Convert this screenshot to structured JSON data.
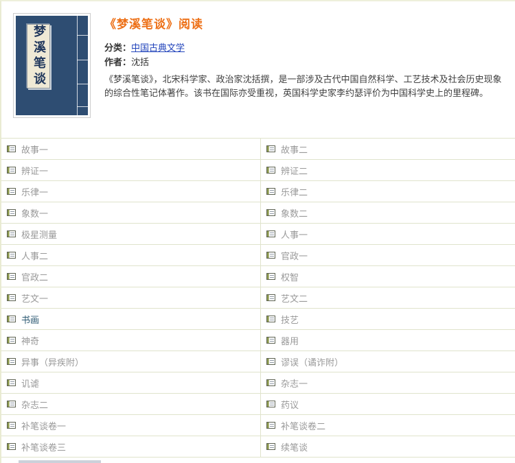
{
  "page": {
    "accent_color": "#ed7017",
    "link_color": "#2244bb",
    "item_color": "#999999",
    "highlight_color": "#2d5a73",
    "cover_color": "#2e4d72",
    "border_color": "#dfe3cb"
  },
  "book": {
    "cover_title": "梦溪笔谈",
    "title": "《梦溪笔谈》阅读",
    "category_label": "分类：",
    "category": "中国古典文学",
    "author_label": "作者：",
    "author": "沈括",
    "description": "《梦溪笔谈》，北宋科学家、政治家沈括撰，是一部涉及古代中国自然科学、工艺技术及社会历史现象的综合性笔记体著作。该书在国际亦受重视，英国科学史家李约瑟评价为中国科学史上的里程碑。"
  },
  "chapters": {
    "icon": "document-icon",
    "items": [
      {
        "label": "故事一"
      },
      {
        "label": "故事二"
      },
      {
        "label": "辨证一"
      },
      {
        "label": "辨证二"
      },
      {
        "label": "乐律一"
      },
      {
        "label": "乐律二"
      },
      {
        "label": "象数一"
      },
      {
        "label": "象数二"
      },
      {
        "label": "极星测量"
      },
      {
        "label": "人事一"
      },
      {
        "label": "人事二"
      },
      {
        "label": "官政一"
      },
      {
        "label": "官政二"
      },
      {
        "label": "权智"
      },
      {
        "label": "艺文一"
      },
      {
        "label": "艺文二"
      },
      {
        "label": "书画",
        "highlighted": true
      },
      {
        "label": "技艺"
      },
      {
        "label": "神奇"
      },
      {
        "label": "器用"
      },
      {
        "label": "异事（异疾附）"
      },
      {
        "label": "谬误（谲诈附）"
      },
      {
        "label": "讥谑"
      },
      {
        "label": "杂志一"
      },
      {
        "label": "杂志二"
      },
      {
        "label": "药议"
      },
      {
        "label": "补笔谈卷一"
      },
      {
        "label": "补笔谈卷二"
      },
      {
        "label": "补笔谈卷三"
      },
      {
        "label": "续笔谈"
      }
    ]
  }
}
